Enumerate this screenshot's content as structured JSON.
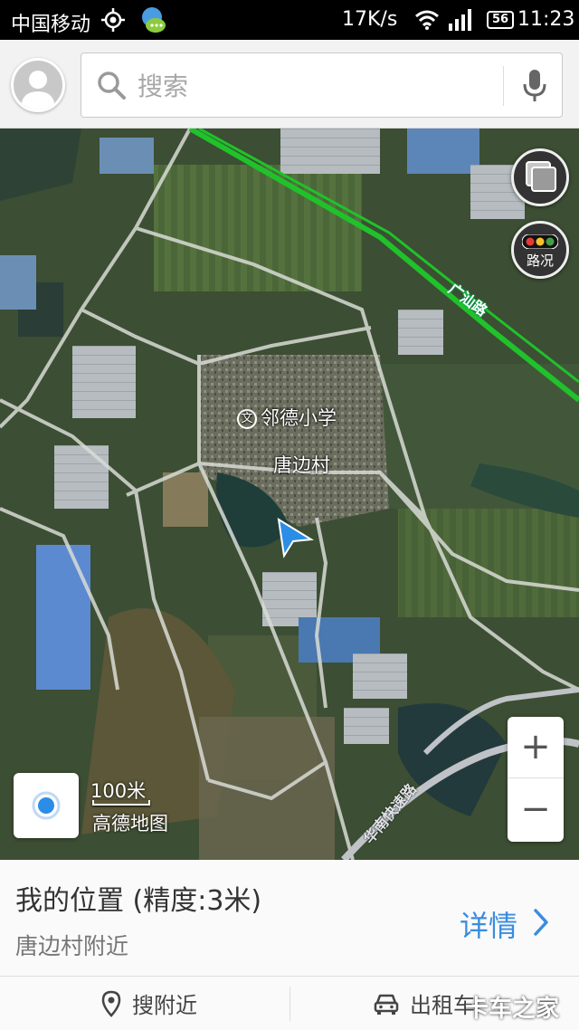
{
  "status_bar": {
    "carrier": "中国移动",
    "network_speed": "17K/s",
    "battery": "56",
    "time": "11:23"
  },
  "search": {
    "placeholder": "搜索"
  },
  "map": {
    "labels": {
      "school": "邻德小学",
      "village": "唐边村",
      "road_north": "广汕路",
      "road_south": "华南快速路"
    },
    "traffic_label": "路况",
    "scale_text": "100米",
    "brand": "高德地图",
    "zoom_in": "+",
    "zoom_out": "−"
  },
  "panel": {
    "title": "我的位置 (精度:3米)",
    "subtitle": "唐边村附近",
    "details_label": "详情",
    "actions": [
      {
        "label": "搜附近",
        "icon": "location-pin-icon"
      },
      {
        "label": "出租车",
        "icon": "taxi-icon"
      }
    ]
  },
  "watermark": "卡车之家",
  "colors": {
    "accent": "#3a8dde",
    "road_highlight": "#1fc22a",
    "location_marker": "#2b8de6"
  }
}
